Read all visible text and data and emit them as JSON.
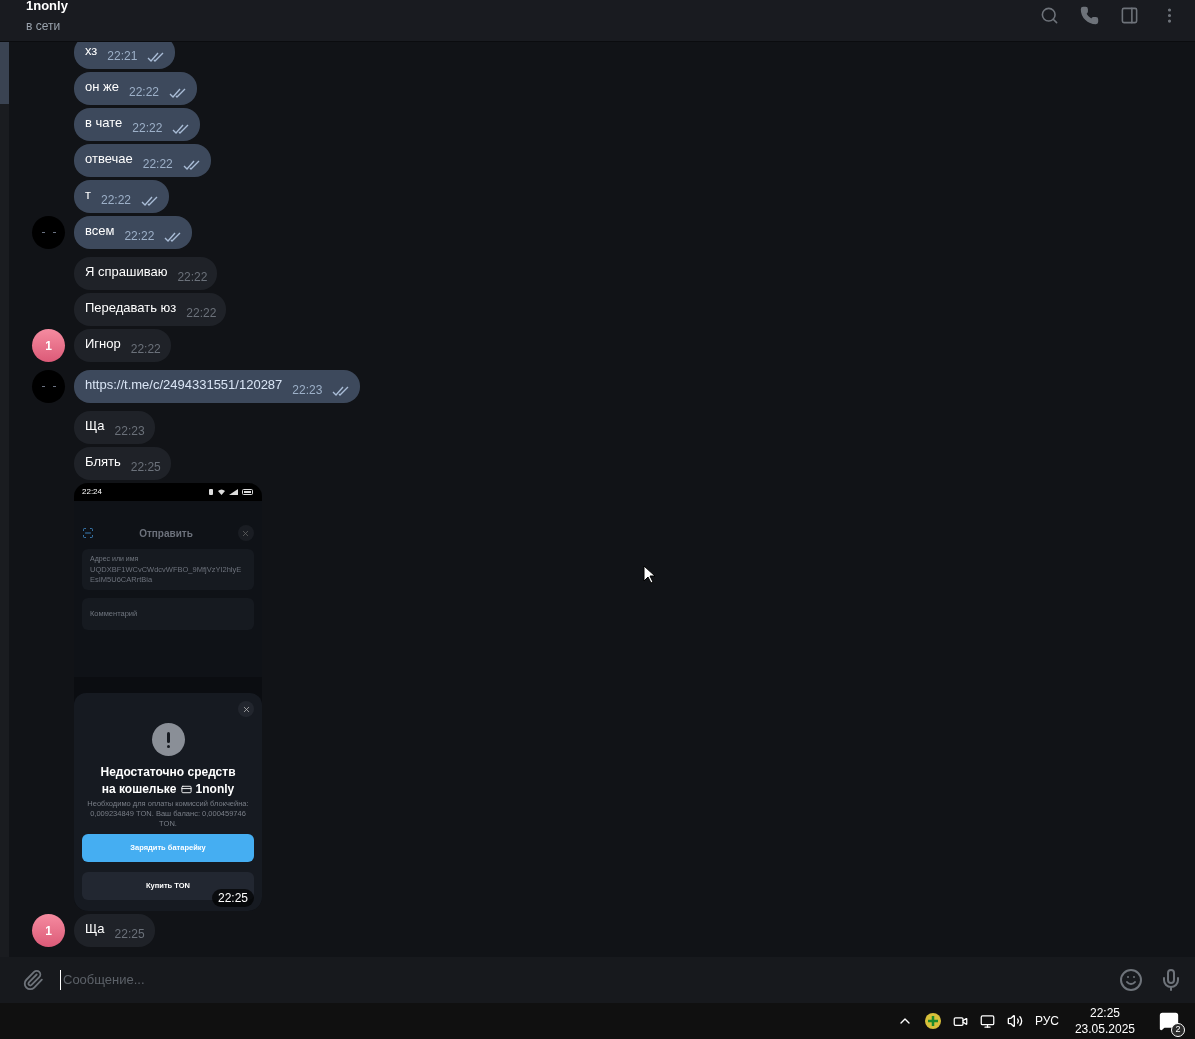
{
  "header": {
    "title": "1nonly",
    "status": "в сети"
  },
  "messages": [
    {
      "kind": "out",
      "text": "хз",
      "time": "22:21"
    },
    {
      "kind": "out",
      "text": "он же",
      "time": "22:22"
    },
    {
      "kind": "out",
      "text": "в чате",
      "time": "22:22"
    },
    {
      "kind": "out",
      "text": "отвечае",
      "time": "22:22"
    },
    {
      "kind": "out",
      "text": "т",
      "time": "22:22"
    },
    {
      "kind": "out",
      "text": "всем",
      "time": "22:22",
      "avatar": {
        "kind": "dark"
      }
    },
    {
      "kind": "in",
      "text": "Я спрашиваю",
      "time": "22:22"
    },
    {
      "kind": "in",
      "text": "Передавать юз",
      "time": "22:22"
    },
    {
      "kind": "in",
      "text": "Игнор",
      "time": "22:22",
      "avatar": {
        "kind": "letter",
        "letter": "1"
      }
    },
    {
      "kind": "out",
      "text": "https://t.me/c/2494331551/120287",
      "time": "22:23",
      "link": true,
      "avatar": {
        "kind": "dark"
      }
    },
    {
      "kind": "in",
      "text": "Ща",
      "time": "22:23"
    },
    {
      "kind": "in",
      "text": "Блять",
      "time": "22:25"
    },
    {
      "kind": "image",
      "time": "22:25",
      "shot": {
        "status_time": "22:24",
        "sheet_title": "Отправить",
        "address_label": "Адрес или имя",
        "address": "UQDXBF1WCvCWdcvWFBO_9MfjVzYI2hlyEEsIM5U6CARrtBia",
        "comment_placeholder": "Комментарий",
        "alert_title_line1": "Недостаточно средств",
        "alert_title_line2": "на кошельке",
        "alert_title_end": "1nonly",
        "alert_text": "Необходимо для оплаты комиссий блокчейна: 0,009234849 TON. Ваш баланс: 0,000459746 TON.",
        "primary_button": "Зарядить батарейку",
        "secondary_button": "Купить TON"
      }
    },
    {
      "kind": "in",
      "text": "Ща",
      "time": "22:25",
      "avatar": {
        "kind": "letter",
        "letter": "1"
      }
    }
  ],
  "composer": {
    "placeholder": "Сообщение..."
  },
  "taskbar": {
    "language": "РУС",
    "time": "22:25",
    "date": "23.05.2025",
    "notifications": "2"
  }
}
